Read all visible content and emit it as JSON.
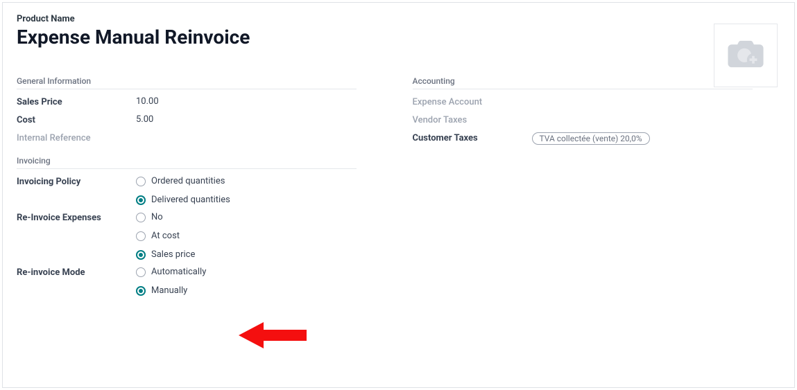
{
  "product_name_label": "Product Name",
  "product_name_value": "Expense Manual Reinvoice",
  "general": {
    "title": "General Information",
    "sales_price_label": "Sales Price",
    "sales_price_value": "10.00",
    "cost_label": "Cost",
    "cost_value": "5.00",
    "internal_ref_label": "Internal Reference"
  },
  "invoicing": {
    "title": "Invoicing",
    "policy_label": "Invoicing Policy",
    "policy_options": {
      "ordered": "Ordered quantities",
      "delivered": "Delivered quantities"
    },
    "reinvoice_label": "Re-Invoice Expenses",
    "reinvoice_options": {
      "no": "No",
      "at_cost": "At cost",
      "sales_price": "Sales price"
    },
    "mode_label": "Re-invoice Mode",
    "mode_options": {
      "auto": "Automatically",
      "manual": "Manually"
    }
  },
  "accounting": {
    "title": "Accounting",
    "expense_account_label": "Expense Account",
    "vendor_taxes_label": "Vendor Taxes",
    "customer_taxes_label": "Customer Taxes",
    "customer_taxes_tag": "TVA collectée (vente) 20,0%"
  }
}
